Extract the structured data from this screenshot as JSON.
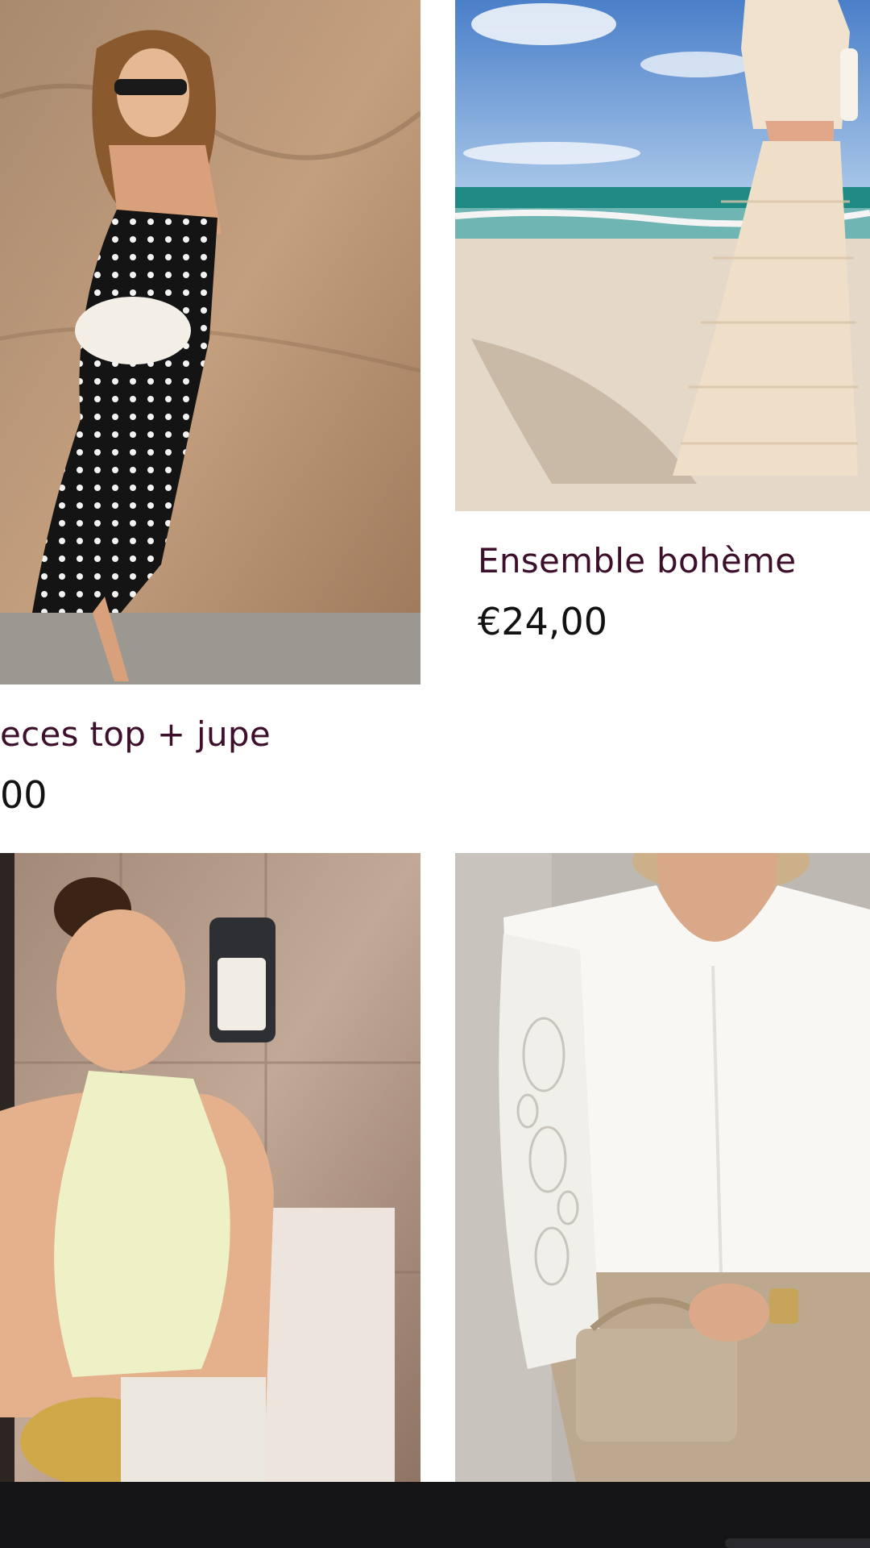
{
  "products": [
    {
      "title": "eces top + jupe",
      "price": "00",
      "image_icon": "product-photo-polka-dot-dress"
    },
    {
      "title": "Ensemble bohème",
      "price": "€24,00",
      "image_icon": "product-photo-beach-ruffle-set"
    },
    {
      "title": "",
      "price": "",
      "image_icon": "product-photo-halter-top"
    },
    {
      "title": "",
      "price": "",
      "image_icon": "product-photo-lace-sleeve-blouse"
    }
  ],
  "colors": {
    "title": "#3d0f2a",
    "price": "#121212",
    "bottom_bar": "#151518"
  }
}
